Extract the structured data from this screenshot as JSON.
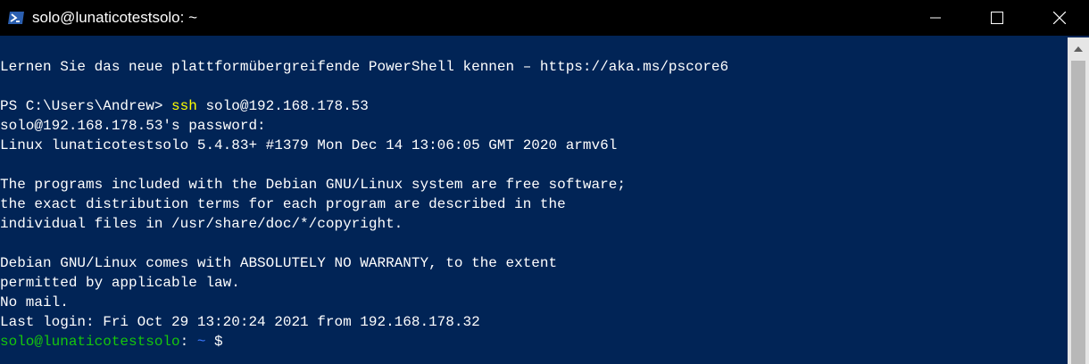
{
  "window": {
    "title": "solo@lunaticotestsolo: ~",
    "app_icon": "powershell-icon",
    "controls": {
      "minimize_icon": "minimize-icon",
      "maximize_icon": "maximize-icon",
      "close_icon": "close-icon"
    }
  },
  "colors": {
    "background": "#012456",
    "titlebar": "#000000",
    "text": "#ffffff",
    "command": "#ffff00",
    "prompt_user": "#16c60c",
    "prompt_path": "#3b78ff"
  },
  "terminal": {
    "line_powershell_info": "Lernen Sie das neue plattformübergreifende PowerShell kennen – https://aka.ms/pscore6",
    "ps_prompt": "PS C:\\Users\\Andrew> ",
    "ps_command": "ssh",
    "ps_args": " solo@192.168.178.53",
    "password_prompt": "solo@192.168.178.53's password:",
    "uname": "Linux lunaticotestsolo 5.4.83+ #1379 Mon Dec 14 13:06:05 GMT 2020 armv6l",
    "motd_1": "The programs included with the Debian GNU/Linux system are free software;",
    "motd_2": "the exact distribution terms for each program are described in the",
    "motd_3": "individual files in /usr/share/doc/*/copyright.",
    "motd_4": "Debian GNU/Linux comes with ABSOLUTELY NO WARRANTY, to the extent",
    "motd_5": "permitted by applicable law.",
    "mail": "No mail.",
    "last_login": "Last login: Fri Oct 29 13:20:24 2021 from 192.168.178.32",
    "prompt_user": "solo@lunaticotestsolo",
    "prompt_sep": ": ",
    "prompt_path": "~",
    "prompt_end": " $"
  }
}
